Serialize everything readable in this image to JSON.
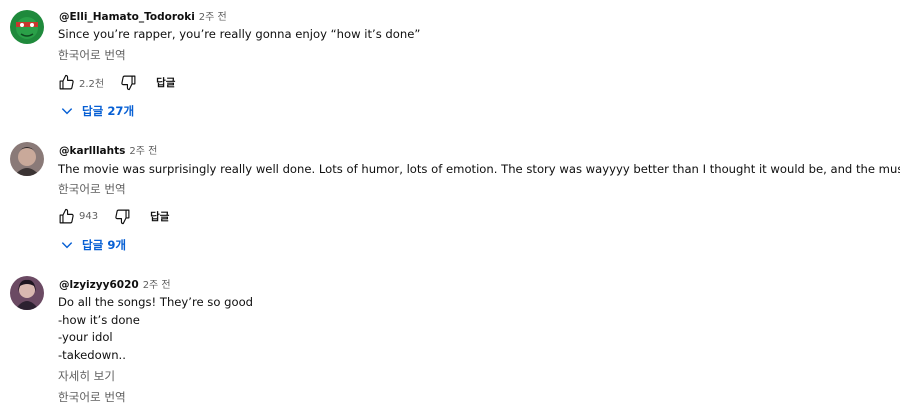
{
  "comments": [
    {
      "author": "@Elli_Hamato_Todoroki",
      "time": "2주 전",
      "text_lines": [
        "Since you’re rapper, you’re really gonna enjoy “how it’s done”"
      ],
      "translate_label": "한국어로 번역",
      "likes": "2.2천",
      "reply_label": "답글",
      "replies_label": "답글 27개",
      "avatar_colors": [
        "#1f8a3c",
        "#c8372d"
      ]
    },
    {
      "author": "@karlllahts",
      "time": "2주 전",
      "text_lines": [
        "The movie was surprisingly really well done. Lots of humor, lots of emotion. The story was wayyyy better than I thought it would be, and the music is"
      ],
      "translate_label": "한국어로 번역",
      "likes": "943",
      "reply_label": "답글",
      "replies_label": "답글 9개",
      "avatar_colors": [
        "#8a7a78",
        "#3b3434"
      ]
    },
    {
      "author": "@lzyizyy6020",
      "time": "2주 전",
      "text_lines": [
        "Do all the songs! They’re so good",
        "-how it’s done",
        "-your idol",
        "-takedown.."
      ],
      "read_more_label": "자세히 보기",
      "translate_label": "한국어로 번역",
      "avatar_colors": [
        "#6b4a63",
        "#2c2130"
      ]
    }
  ],
  "icons": {
    "like": "thumbs-up-icon",
    "dislike": "thumbs-down-icon",
    "expand": "chevron-down-icon",
    "emoji": "fire-icon"
  },
  "colors": {
    "link_blue": "#065fd4",
    "secondary_text": "#606060"
  }
}
